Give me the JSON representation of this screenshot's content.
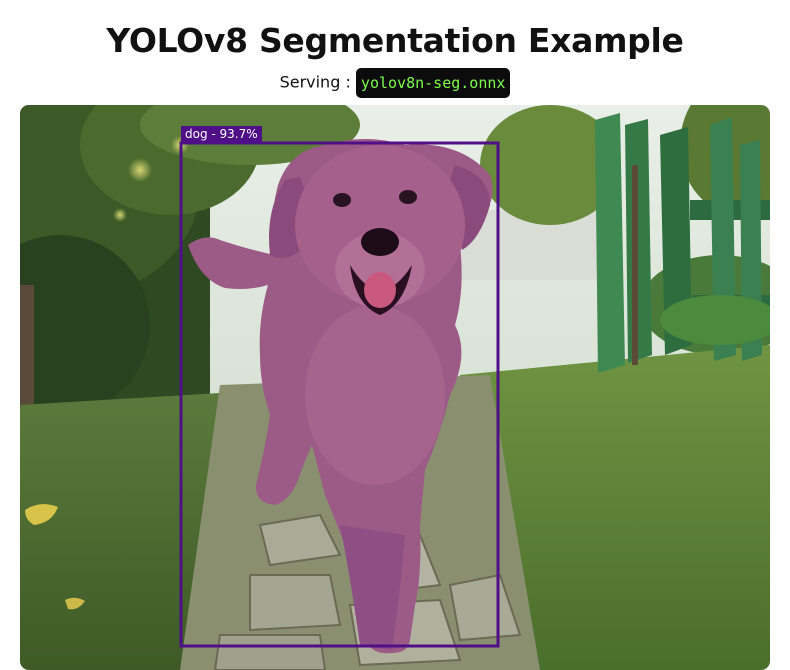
{
  "header": {
    "title": "YOLOv8 Segmentation Example",
    "serving_label": "Serving :",
    "model_name": "yolov8n-seg.onnx"
  },
  "detection": {
    "label": "dog - 93.7%",
    "class": "dog",
    "confidence": 93.7,
    "box_color": "#4f0f86",
    "mask_color": "#8e2fb3"
  },
  "colors": {
    "model_text": "#7cff4a",
    "model_background": "#0c0c0c"
  }
}
